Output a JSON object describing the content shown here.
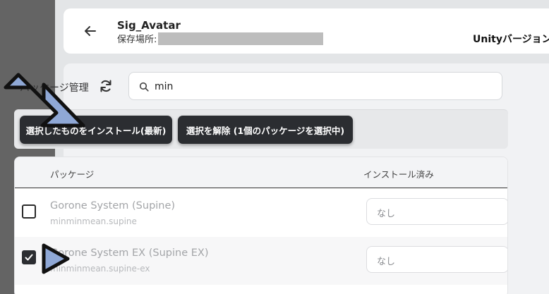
{
  "header": {
    "project_name": "Sig_Avatar",
    "location_label": "保存場所:",
    "unity_label": "Unityバージョン:"
  },
  "packages": {
    "title": "パッケージ管理",
    "search": {
      "value": "min",
      "placeholder": ""
    },
    "actions": {
      "install_label": "選択したものをインストール(最新)",
      "deselect_label": "選択を解除 (1個のパッケージを選択中)"
    },
    "table": {
      "col_package": "パッケージ",
      "col_installed": "インストール済み",
      "rows": [
        {
          "name": "Gorone System (Supine)",
          "id": "minminmean.supine",
          "installed": "なし",
          "checked": false
        },
        {
          "name": "Gorone System EX (Supine EX)",
          "id": "minminmean.supine-ex",
          "installed": "なし",
          "checked": true
        }
      ]
    }
  },
  "colors": {
    "sidebar": "#646464",
    "button_dark": "#2b2d31",
    "annotation_arrow": "#8fa8d6"
  },
  "icons": [
    "back-arrow-icon",
    "refresh-icon",
    "search-icon",
    "check-icon",
    "annotation-arrow-icon"
  ]
}
